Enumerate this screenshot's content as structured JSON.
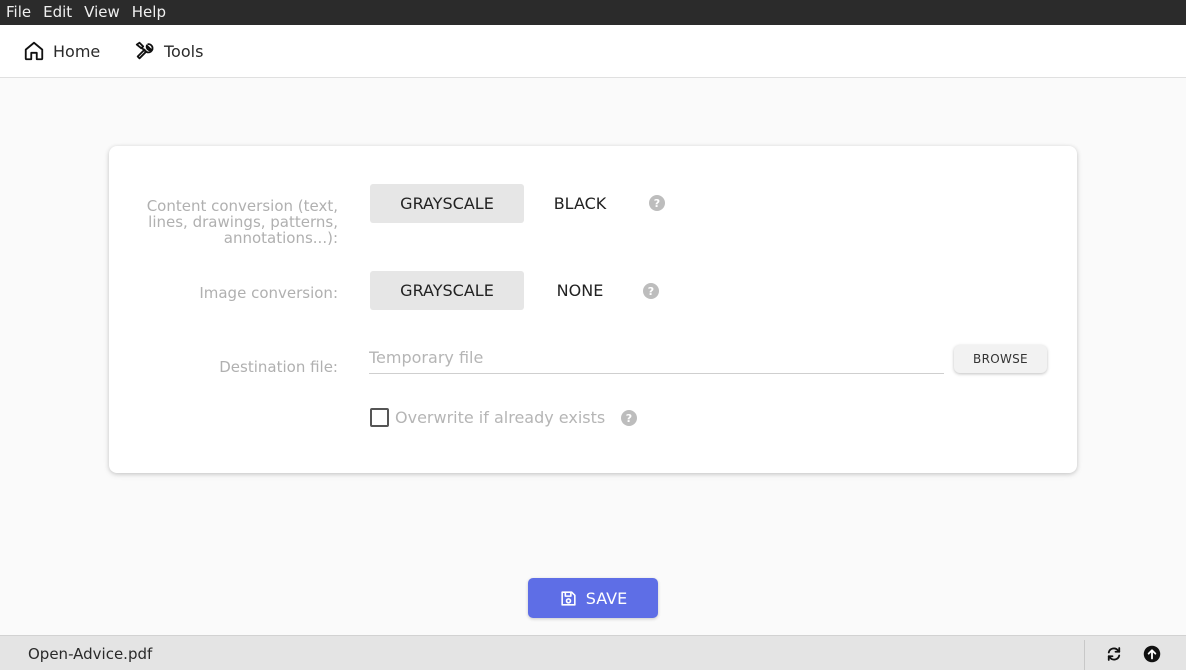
{
  "menu": {
    "items": [
      "File",
      "Edit",
      "View",
      "Help"
    ]
  },
  "toolbar": {
    "home_label": "Home",
    "home_icon": "home-icon",
    "tools_label": "Tools",
    "tools_icon": "tools-icon"
  },
  "form": {
    "content_conversion": {
      "label": "Content conversion (text, lines, drawings, patterns, annotations...):",
      "options": [
        "GRAYSCALE",
        "BLACK"
      ],
      "selected": "GRAYSCALE",
      "help": "?"
    },
    "image_conversion": {
      "label": "Image conversion:",
      "options": [
        "GRAYSCALE",
        "NONE"
      ],
      "selected": "GRAYSCALE",
      "help": "?"
    },
    "destination": {
      "label": "Destination file:",
      "value": "",
      "placeholder": "Temporary file",
      "browse_label": "BROWSE"
    },
    "overwrite": {
      "label": "Overwrite if already exists",
      "checked": false,
      "help": "?"
    }
  },
  "save": {
    "label": "SAVE",
    "icon": "save-icon"
  },
  "statusbar": {
    "filename": "Open-Advice.pdf",
    "icons": [
      "refresh-icon",
      "arrow-up-icon"
    ]
  },
  "colors": {
    "menubar_bg": "#2b2b2b",
    "accent": "#5e6ee6",
    "segment_active_bg": "#e6e6e6",
    "statusbar_bg": "#e4e4e4"
  }
}
